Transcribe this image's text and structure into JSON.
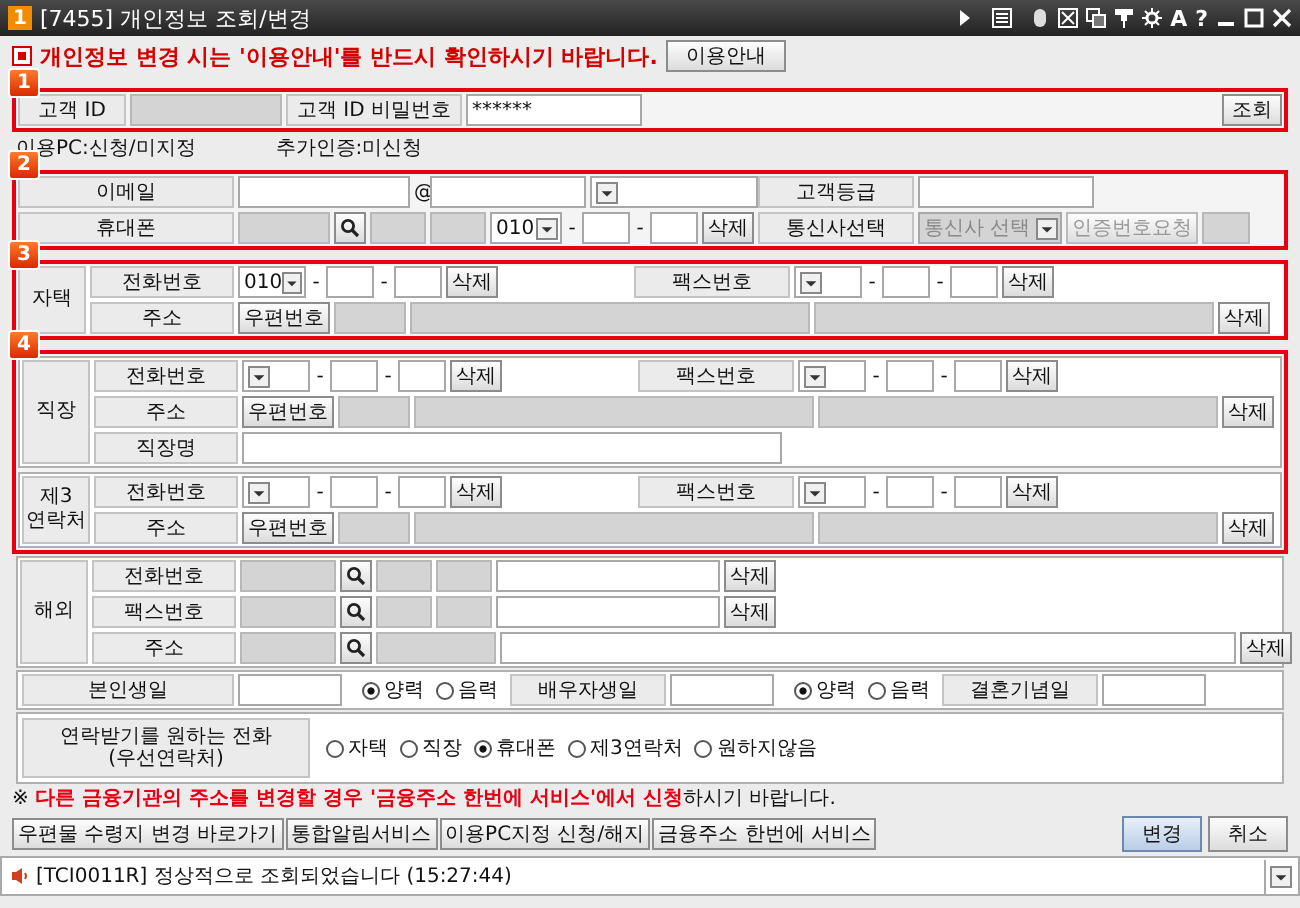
{
  "window": {
    "badge": "1",
    "title": "[7455] 개인정보 조회/변경",
    "glyphs": [
      "A",
      "?"
    ]
  },
  "notice": {
    "text": "개인정보 변경 시는 '이용안내'를 반드시 확인하시기 바랍니다.",
    "button": "이용안내"
  },
  "section1": {
    "number": "1",
    "id_label": "고객 ID",
    "password_label": "고객 ID 비밀번호",
    "password_value": "******",
    "button": "조회"
  },
  "status_items": [
    "이용PC:신청/미지정",
    "추가인증:미신청"
  ],
  "section2": {
    "number": "2",
    "email_label": "이메일",
    "at": "@",
    "grade_label": "고객등급",
    "mobile_label": "휴대폰",
    "mobile": {
      "prefix": "010",
      "separators": [
        "-",
        "-"
      ],
      "delete": "삭제"
    },
    "carrier_label": "통신사선택",
    "carrier_select": {
      "value": "통신사 선택",
      "disabled": true
    },
    "cert_button": {
      "label": "인증번호요청",
      "disabled": true
    }
  },
  "section3": {
    "number": "3",
    "group": "자택",
    "phone_label": "전화번호",
    "phone": {
      "prefix": "010",
      "separators": [
        "-",
        "-"
      ],
      "delete": "삭제"
    },
    "fax_label": "팩스번호",
    "fax": {
      "separators": [
        "-",
        "-"
      ],
      "delete": "삭제"
    },
    "address_label": "주소",
    "zip_button": "우편번호",
    "address_delete": "삭제"
  },
  "section4": {
    "number": "4",
    "groups": [
      {
        "group": "직장",
        "phone_label": "전화번호",
        "phone": {
          "separators": [
            "-",
            "-"
          ],
          "delete": "삭제"
        },
        "fax_label": "팩스번호",
        "fax": {
          "separators": [
            "-",
            "-"
          ],
          "delete": "삭제"
        },
        "address_label": "주소",
        "zip_button": "우편번호",
        "address_delete": "삭제",
        "company_label": "직장명"
      },
      {
        "group": "제3\n연락처",
        "phone_label": "전화번호",
        "phone": {
          "separators": [
            "-",
            "-"
          ],
          "delete": "삭제"
        },
        "fax_label": "팩스번호",
        "fax": {
          "separators": [
            "-",
            "-"
          ],
          "delete": "삭제"
        },
        "address_label": "주소",
        "zip_button": "우편번호",
        "address_delete": "삭제"
      }
    ]
  },
  "overseas": {
    "group": "해외",
    "rows": [
      {
        "label": "전화번호",
        "kind": "phone",
        "delete": "삭제"
      },
      {
        "label": "팩스번호",
        "kind": "phone",
        "delete": "삭제"
      },
      {
        "label": "주소",
        "kind": "address",
        "delete": "삭제"
      }
    ]
  },
  "birthdays": [
    {
      "label": "본인생일",
      "options": [
        {
          "label": "양력",
          "selected": true
        },
        {
          "label": "음력",
          "selected": false
        }
      ]
    },
    {
      "label": "배우자생일",
      "options": [
        {
          "label": "양력",
          "selected": true
        },
        {
          "label": "음력",
          "selected": false
        }
      ]
    },
    {
      "label": "결혼기념일"
    }
  ],
  "preferred_contact": {
    "label": "연락받기를 원하는 전화\n(우선연락처)",
    "options": [
      {
        "label": "자택",
        "selected": false
      },
      {
        "label": "직장",
        "selected": false
      },
      {
        "label": "휴대폰",
        "selected": true
      },
      {
        "label": "제3연락처",
        "selected": false
      },
      {
        "label": "원하지않음",
        "selected": false
      }
    ]
  },
  "footer_notice": "※ **다른 금융기관의 주소를 변경할 경우 '금융주소 한번에 서비스'에서 신청**하시기 바랍니다.",
  "link_buttons": [
    "우편물 수령지 변경 바로가기",
    "통합알림서비스",
    "이용PC지정 신청/해지",
    "금융주소 한번에 서비스"
  ],
  "action_buttons": [
    {
      "label": "변경",
      "kind": "primary"
    },
    {
      "label": "취소",
      "kind": "normal"
    }
  ],
  "status_bar": {
    "message": "[TCI0011R] 정상적으로 조회되었습니다 (15:27:44)"
  }
}
